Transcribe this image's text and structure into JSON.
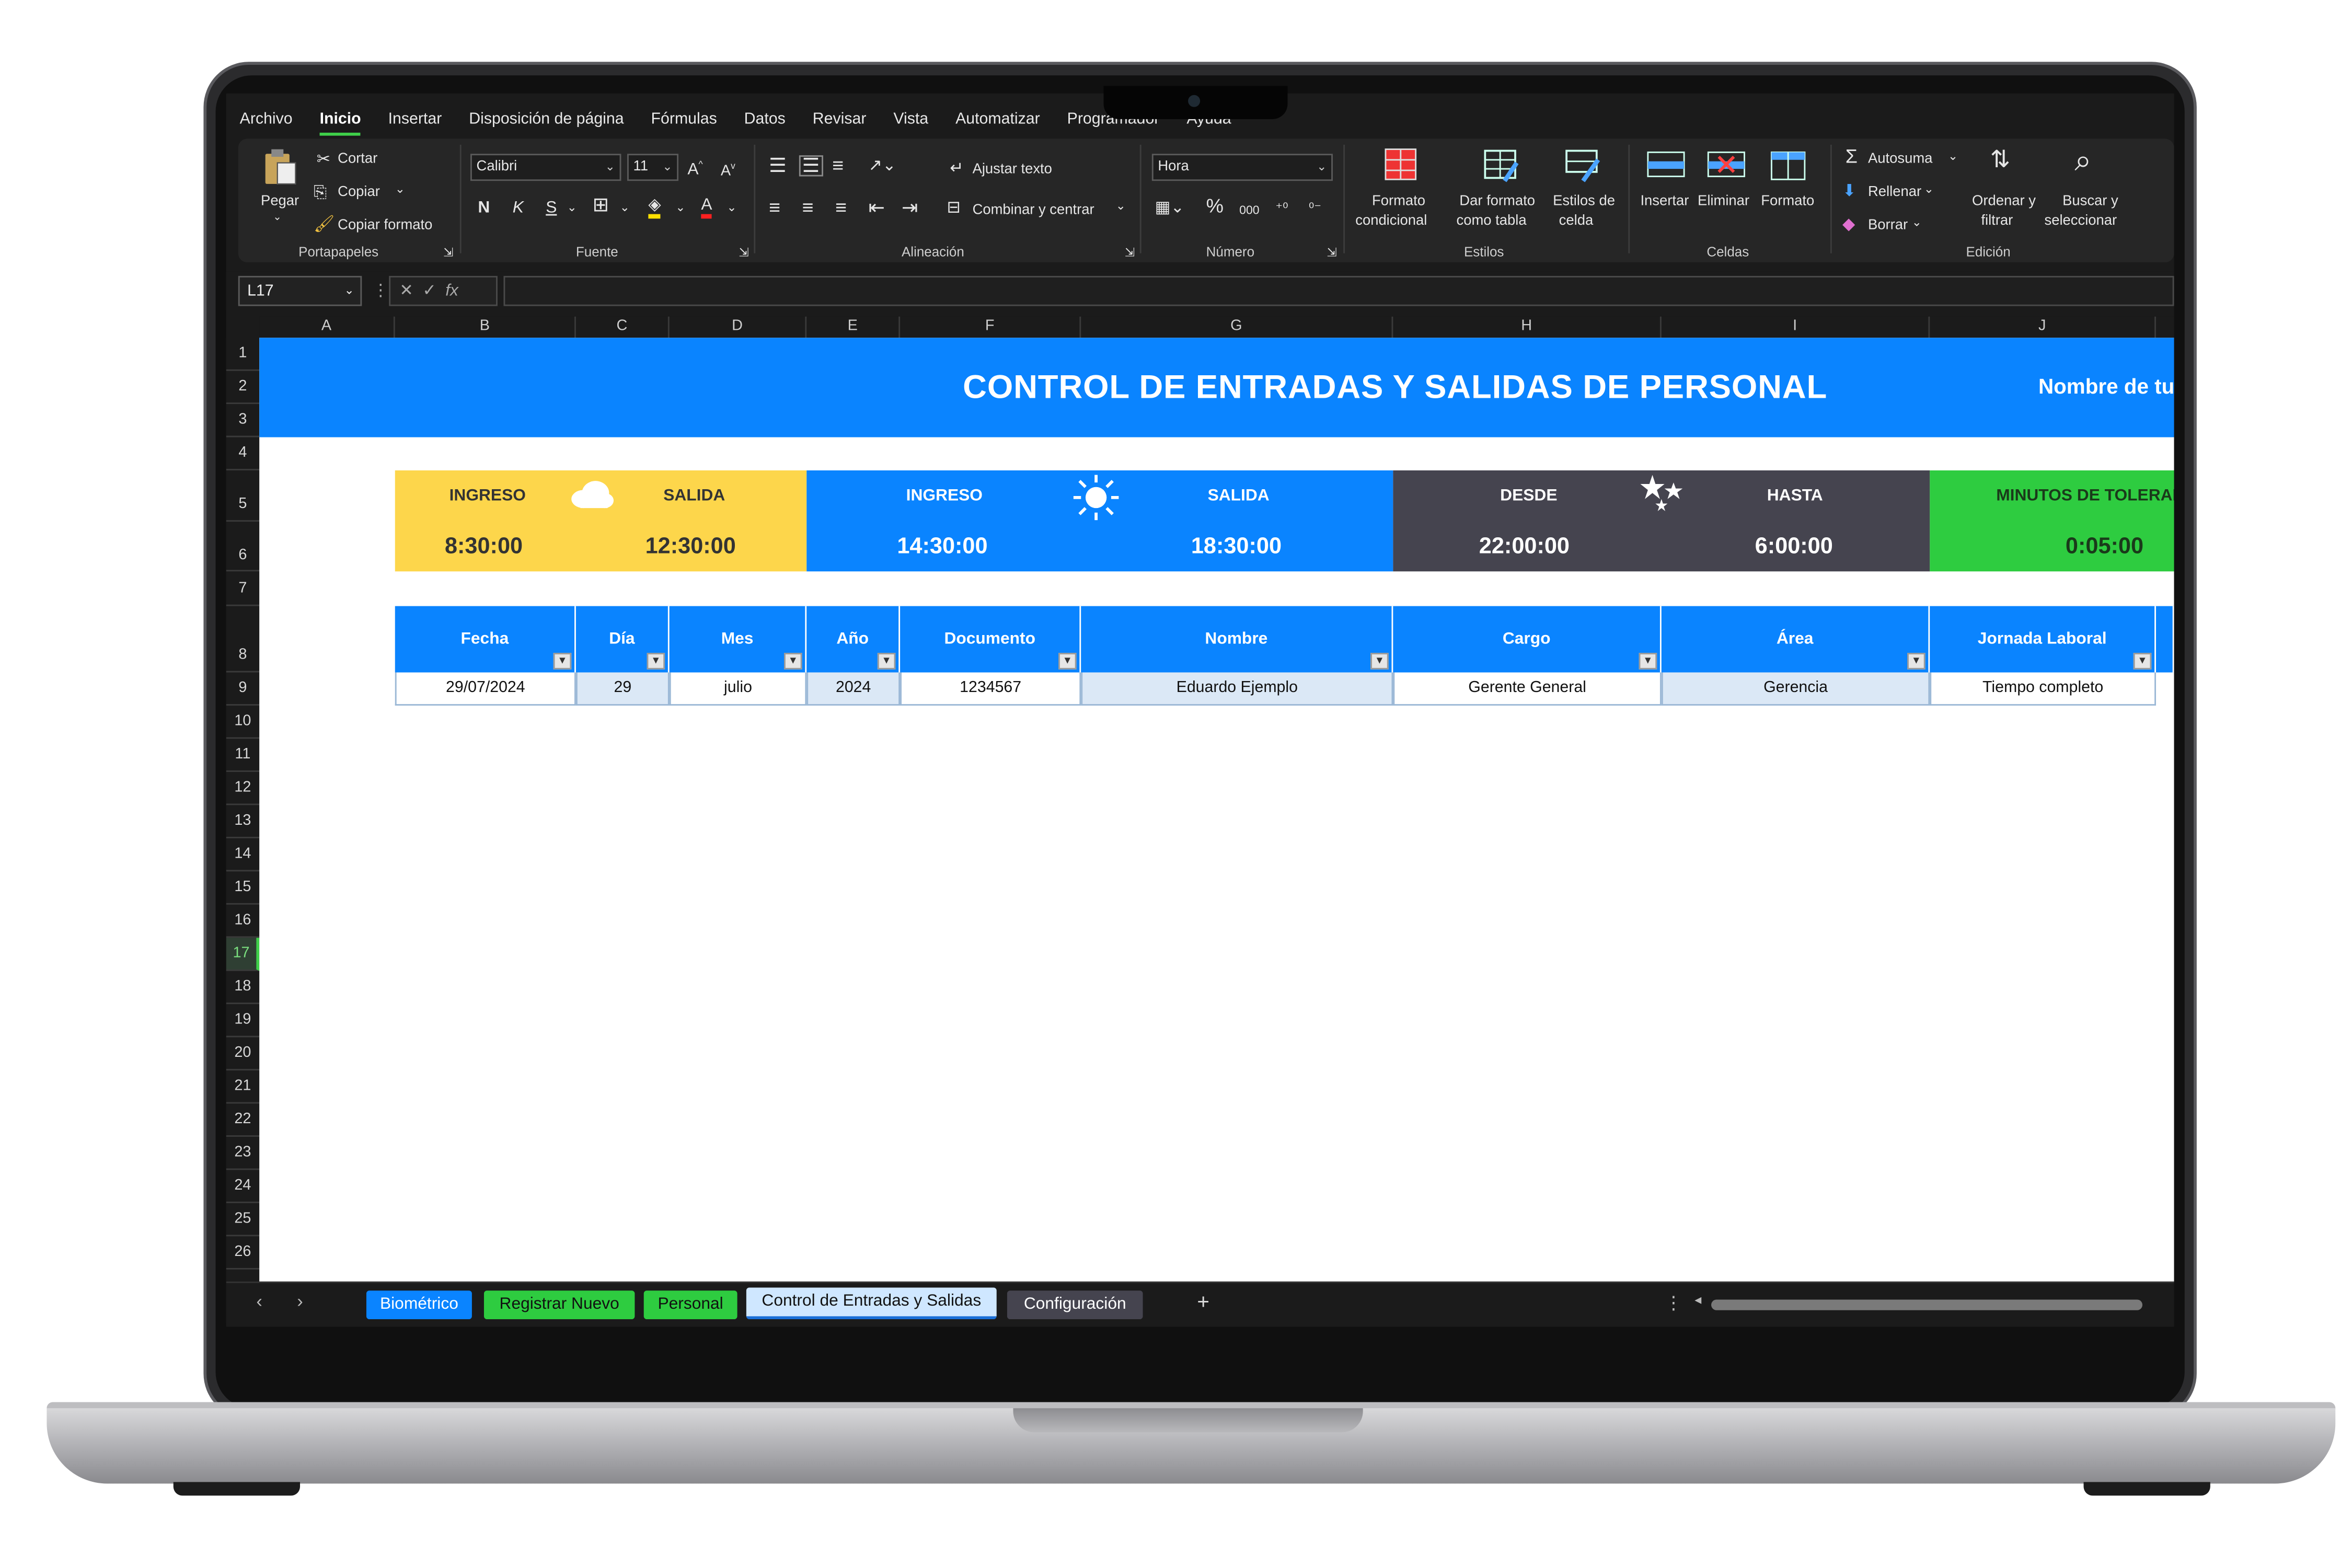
{
  "menu": [
    "Archivo",
    "Inicio",
    "Insertar",
    "Disposición de página",
    "Fórmulas",
    "Datos",
    "Revisar",
    "Vista",
    "Automatizar",
    "Programador",
    "Ayuda"
  ],
  "ribbon": {
    "portapapeles": {
      "paste": "Pegar",
      "cut": "Cortar",
      "copy": "Copiar",
      "format_painter": "Copiar formato",
      "label": "Portapapeles"
    },
    "fuente": {
      "font": "Calibri",
      "size": "11",
      "bold": "N",
      "italic": "K",
      "underline": "S",
      "label": "Fuente"
    },
    "alineacion": {
      "wrap": "Ajustar texto",
      "merge": "Combinar y centrar",
      "label": "Alineación"
    },
    "numero": {
      "format": "Hora",
      "percent": "%",
      "thousands": "000",
      "label": "Número"
    },
    "estilos": {
      "conditional_1": "Formato",
      "conditional_2": "condicional",
      "table_1": "Dar formato",
      "table_2": "como tabla",
      "cell_1": "Estilos de",
      "cell_2": "celda",
      "label": "Estilos"
    },
    "celdas": {
      "insert": "Insertar",
      "delete": "Eliminar",
      "format": "Formato",
      "label": "Celdas"
    },
    "edicion": {
      "autosum": "Autosuma",
      "fill": "Rellenar",
      "clear": "Borrar",
      "sort_1": "Ordenar y",
      "sort_2": "filtrar",
      "find_1": "Buscar y",
      "find_2": "seleccionar",
      "label": "Edición"
    }
  },
  "formula_bar": {
    "name_box": "L17",
    "fx": "fx",
    "value": ""
  },
  "columns": [
    "A",
    "B",
    "C",
    "D",
    "E",
    "F",
    "G",
    "H",
    "I",
    "J"
  ],
  "rows": [
    "1",
    "2",
    "3",
    "4",
    "5",
    "6",
    "7",
    "8",
    "9",
    "10",
    "11",
    "12",
    "13",
    "14",
    "15",
    "16",
    "17",
    "18",
    "19",
    "20",
    "21",
    "22",
    "23",
    "24",
    "25",
    "26"
  ],
  "sheet": {
    "title": "CONTROL DE ENTRADAS Y SALIDAS DE PERSONAL",
    "title_right": "Nombre de tu",
    "shifts": [
      {
        "l1": "INGRESO",
        "l2": "SALIDA",
        "v1": "8:30:00",
        "v2": "12:30:00",
        "color": "#fdd64b",
        "icon": "cloud-icon"
      },
      {
        "l1": "INGRESO",
        "l2": "SALIDA",
        "v1": "14:30:00",
        "v2": "18:30:00",
        "color": "#0a84ff",
        "icon": "sun-icon"
      },
      {
        "l1": "DESDE",
        "l2": "HASTA",
        "v1": "22:00:00",
        "v2": "6:00:00",
        "color": "#45444f",
        "icon": "stars-icon"
      },
      {
        "l1": "MINUTOS DE TOLERANCIA",
        "v1": "0:05:00",
        "color": "#2ecc40"
      }
    ],
    "headers": [
      "Fecha",
      "Día",
      "Mes",
      "Año",
      "Documento",
      "Nombre",
      "Cargo",
      "Área",
      "Jornada Laboral"
    ],
    "row": [
      "29/07/2024",
      "29",
      "julio",
      "2024",
      "1234567",
      "Eduardo Ejemplo",
      "Gerente General",
      "Gerencia",
      "Tiempo completo"
    ]
  },
  "tabs": [
    {
      "label": "Biométrico",
      "color": "#0a84ff"
    },
    {
      "label": "Registrar Nuevo",
      "color": "#2ecc40"
    },
    {
      "label": "Personal",
      "color": "#2ecc40"
    },
    {
      "label": "Control de Entradas y Salidas",
      "color": "#cfe7ff"
    },
    {
      "label": "Configuración",
      "color": "#45444f"
    }
  ],
  "add_sheet": "+"
}
